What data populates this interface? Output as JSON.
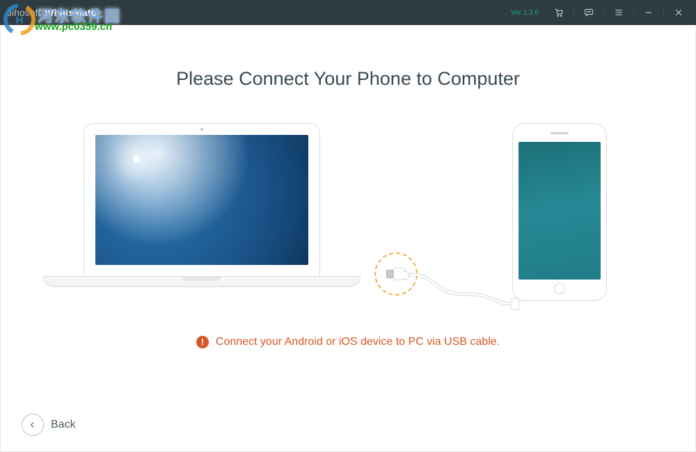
{
  "titlebar": {
    "brand_prefix": "Jihosoft",
    "brand_name": "WhatsMate",
    "version_label": "Ver:1.3.6"
  },
  "watermark": {
    "site_name_cn": "河东软件园",
    "site_url": "www.pc0359.cn"
  },
  "main": {
    "title": "Please Connect Your Phone to Computer"
  },
  "hint": {
    "text": "Connect your Android or iOS device to PC via USB cable."
  },
  "back": {
    "label": "Back"
  },
  "colors": {
    "accent": "#d85626",
    "teal": "#1aa38c",
    "titlebar": "#2e3b40"
  }
}
